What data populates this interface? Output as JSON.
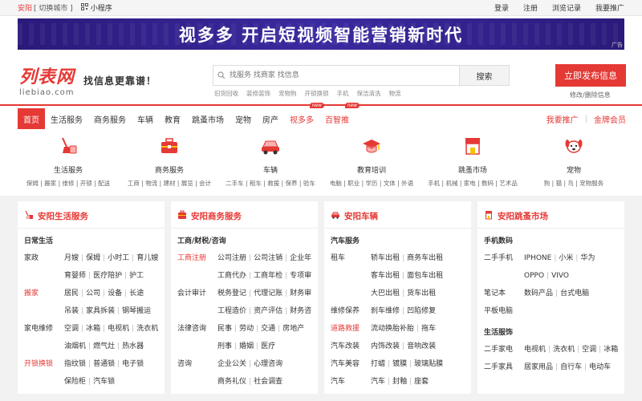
{
  "topbar": {
    "city": "安阳",
    "switch_city": "[ 切换城市 ]",
    "mini_program": "小程序",
    "links": [
      "登录",
      "注册",
      "浏览记录",
      "我要推广"
    ]
  },
  "banner": {
    "text": "视多多 开启短视频智能营销新时代",
    "ad_label": "广告"
  },
  "header": {
    "logo_cn": "列表网",
    "logo_en": "liebiao.com",
    "slogan": "找信息更靠谱！",
    "search_placeholder": "找服务 找商家 找信息",
    "search_button": "搜索",
    "hot_words": [
      "旧货回收",
      "装修装饰",
      "宠物狗",
      "开锁换锁",
      "手机",
      "保洁清洗",
      "物流"
    ],
    "publish_button": "立即发布信息",
    "edit_link": "修改/删除信息"
  },
  "nav": {
    "items": [
      {
        "label": "首页"
      },
      {
        "label": "生活服务"
      },
      {
        "label": "商务服务"
      },
      {
        "label": "车辆"
      },
      {
        "label": "教育"
      },
      {
        "label": "跳蚤市场"
      },
      {
        "label": "宠物"
      },
      {
        "label": "房产"
      },
      {
        "label": "视多多",
        "badge": "new"
      },
      {
        "label": "百智推",
        "badge": "new"
      }
    ],
    "right": [
      "我要推广",
      "金牌会员"
    ]
  },
  "categories": [
    {
      "name": "生活服务",
      "subs": "保姆 | 搬家 | 维修 | 开锁 | 配送",
      "icon": "broom-bucket-icon"
    },
    {
      "name": "商务服务",
      "subs": "工商 | 物流 | 建材 | 展览 | 会计",
      "icon": "briefcase-icon"
    },
    {
      "name": "车辆",
      "subs": "二手车 | 租车 | 救援 | 保养 | 验车",
      "icon": "car-icon"
    },
    {
      "name": "教育培训",
      "subs": "电脑 | 职业 | 学历 | 文体 | 外语",
      "icon": "graduation-cap-icon"
    },
    {
      "name": "跳蚤市场",
      "subs": "手机 | 机械 | 家电 | 数码 | 艺术品",
      "icon": "shop-icon"
    },
    {
      "name": "宠物",
      "subs": "狗 | 猫 | 鸟 | 宠物服务",
      "icon": "dog-icon"
    }
  ],
  "panels": [
    {
      "title": "安阳生活服务",
      "groups": [
        {
          "name": "日常生活",
          "rows": [
            {
              "label": "家政",
              "values": [
                "月嫂",
                "保姆",
                "小时工",
                "育儿嫂"
              ]
            },
            {
              "label": "",
              "values": [
                "育婴师",
                "医疗陪护",
                "护工"
              ]
            },
            {
              "label": "搬家",
              "red": true,
              "values": [
                "居民",
                "公司",
                "设备",
                "长途"
              ]
            },
            {
              "label": "",
              "values": [
                "吊装",
                "家具拆装",
                "钢琴搬运"
              ]
            },
            {
              "label": "家电维修",
              "values": [
                "空调",
                "冰箱",
                "电视机",
                "洗衣机"
              ]
            },
            {
              "label": "",
              "values": [
                "油烟机",
                "燃气灶",
                "热水器"
              ]
            },
            {
              "label": "开锁换锁",
              "red": true,
              "values": [
                "指纹锁",
                "普通锁",
                "电子锁"
              ]
            },
            {
              "label": "",
              "values": [
                "保险柜",
                "汽车锁"
              ]
            }
          ]
        }
      ]
    },
    {
      "title": "安阳商务服务",
      "groups": [
        {
          "name": "工商/财税/咨询",
          "rows": [
            {
              "label": "工商注册",
              "red": true,
              "values": [
                "公司注册",
                "公司注销",
                "企业年检"
              ]
            },
            {
              "label": "",
              "values": [
                "工商代办",
                "工商年检",
                "专项审批"
              ]
            },
            {
              "label": "会计审计",
              "values": [
                "税务登记",
                "代理记账",
                "财务审计"
              ]
            },
            {
              "label": "",
              "values": [
                "工程造价",
                "资产评估",
                "财务咨询"
              ]
            },
            {
              "label": "法律咨询",
              "values": [
                "民事",
                "劳动",
                "交通",
                "房地产"
              ]
            },
            {
              "label": "",
              "values": [
                "刑事",
                "婚姻",
                "医疗"
              ]
            },
            {
              "label": "咨询",
              "values": [
                "企业公关",
                "心理咨询"
              ]
            },
            {
              "label": "",
              "values": [
                "商务礼仪",
                "社会调查"
              ]
            }
          ]
        }
      ]
    },
    {
      "title": "安阳车辆",
      "groups": [
        {
          "name": "汽车服务",
          "rows": [
            {
              "label": "租车",
              "values": [
                "轿车出租",
                "商务车出租"
              ]
            },
            {
              "label": "",
              "values": [
                "客车出租",
                "面包车出租"
              ]
            },
            {
              "label": "",
              "values": [
                "大巴出租",
                "货车出租"
              ]
            },
            {
              "label": "维修保养",
              "values": [
                "刹车维修",
                "凹陷修复"
              ]
            },
            {
              "label": "道路救援",
              "red": true,
              "values": [
                "流动换胎补胎",
                "拖车"
              ]
            },
            {
              "label": "汽车改装",
              "values": [
                "内饰改装",
                "音响改装"
              ]
            },
            {
              "label": "汽车美容",
              "values": [
                "打蜡",
                "镀膜",
                "玻璃贴膜"
              ]
            },
            {
              "label": "汽车",
              "values": [
                "汽车",
                "封釉",
                "座套"
              ]
            }
          ]
        }
      ]
    },
    {
      "title": "安阳跳蚤市场",
      "groups": [
        {
          "name": "手机数码",
          "rows": [
            {
              "label": "二手手机",
              "values": [
                "IPHONE",
                "小米",
                "华为"
              ]
            },
            {
              "label": "",
              "values": [
                "OPPO",
                "VIVO"
              ]
            },
            {
              "label": "笔记本",
              "values": [
                "数码产品",
                "台式电脑"
              ]
            },
            {
              "label": "平板电脑",
              "values": []
            }
          ]
        },
        {
          "name": "生活服饰",
          "rows": [
            {
              "label": "二手家电",
              "values": [
                "电视机",
                "洗衣机",
                "空调",
                "冰箱"
              ]
            },
            {
              "label": "二手家具",
              "values": [
                "居家用品",
                "自行车",
                "电动车"
              ]
            }
          ]
        }
      ]
    }
  ],
  "colors": {
    "accent": "#e53935",
    "banner": "#2b1a7a"
  }
}
